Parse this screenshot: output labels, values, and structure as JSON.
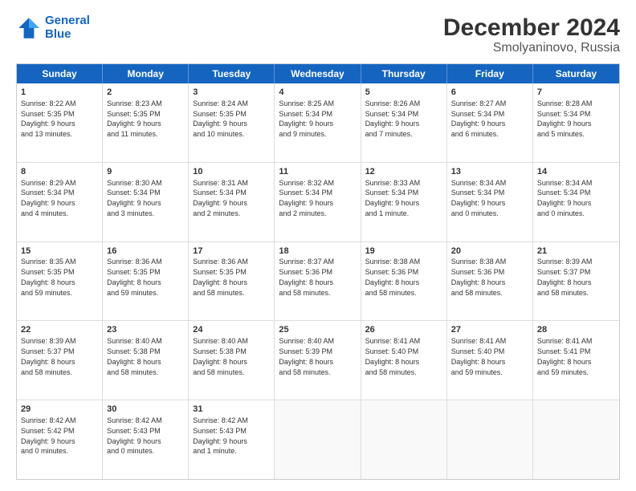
{
  "header": {
    "logo_line1": "General",
    "logo_line2": "Blue",
    "main_title": "December 2024",
    "subtitle": "Smolyaninovo, Russia"
  },
  "calendar": {
    "days_of_week": [
      "Sunday",
      "Monday",
      "Tuesday",
      "Wednesday",
      "Thursday",
      "Friday",
      "Saturday"
    ],
    "weeks": [
      [
        {
          "day": "",
          "text": "",
          "empty": true
        },
        {
          "day": "",
          "text": "",
          "empty": true
        },
        {
          "day": "",
          "text": "",
          "empty": true
        },
        {
          "day": "",
          "text": "",
          "empty": true
        },
        {
          "day": "5",
          "text": "Sunrise: 8:26 AM\nSunset: 5:34 PM\nDaylight: 9 hours\nand 7 minutes.",
          "empty": false
        },
        {
          "day": "6",
          "text": "Sunrise: 8:27 AM\nSunset: 5:34 PM\nDaylight: 9 hours\nand 6 minutes.",
          "empty": false
        },
        {
          "day": "7",
          "text": "Sunrise: 8:28 AM\nSunset: 5:34 PM\nDaylight: 9 hours\nand 5 minutes.",
          "empty": false
        }
      ],
      [
        {
          "day": "1",
          "text": "Sunrise: 8:22 AM\nSunset: 5:35 PM\nDaylight: 9 hours\nand 13 minutes.",
          "empty": false
        },
        {
          "day": "2",
          "text": "Sunrise: 8:23 AM\nSunset: 5:35 PM\nDaylight: 9 hours\nand 11 minutes.",
          "empty": false
        },
        {
          "day": "3",
          "text": "Sunrise: 8:24 AM\nSunset: 5:35 PM\nDaylight: 9 hours\nand 10 minutes.",
          "empty": false
        },
        {
          "day": "4",
          "text": "Sunrise: 8:25 AM\nSunset: 5:34 PM\nDaylight: 9 hours\nand 9 minutes.",
          "empty": false
        },
        {
          "day": "5",
          "text": "Sunrise: 8:26 AM\nSunset: 5:34 PM\nDaylight: 9 hours\nand 7 minutes.",
          "empty": false
        },
        {
          "day": "6",
          "text": "Sunrise: 8:27 AM\nSunset: 5:34 PM\nDaylight: 9 hours\nand 6 minutes.",
          "empty": false
        },
        {
          "day": "7",
          "text": "Sunrise: 8:28 AM\nSunset: 5:34 PM\nDaylight: 9 hours\nand 5 minutes.",
          "empty": false
        }
      ],
      [
        {
          "day": "8",
          "text": "Sunrise: 8:29 AM\nSunset: 5:34 PM\nDaylight: 9 hours\nand 4 minutes.",
          "empty": false
        },
        {
          "day": "9",
          "text": "Sunrise: 8:30 AM\nSunset: 5:34 PM\nDaylight: 9 hours\nand 3 minutes.",
          "empty": false
        },
        {
          "day": "10",
          "text": "Sunrise: 8:31 AM\nSunset: 5:34 PM\nDaylight: 9 hours\nand 2 minutes.",
          "empty": false
        },
        {
          "day": "11",
          "text": "Sunrise: 8:32 AM\nSunset: 5:34 PM\nDaylight: 9 hours\nand 2 minutes.",
          "empty": false
        },
        {
          "day": "12",
          "text": "Sunrise: 8:33 AM\nSunset: 5:34 PM\nDaylight: 9 hours\nand 1 minute.",
          "empty": false
        },
        {
          "day": "13",
          "text": "Sunrise: 8:34 AM\nSunset: 5:34 PM\nDaylight: 9 hours\nand 0 minutes.",
          "empty": false
        },
        {
          "day": "14",
          "text": "Sunrise: 8:34 AM\nSunset: 5:34 PM\nDaylight: 9 hours\nand 0 minutes.",
          "empty": false
        }
      ],
      [
        {
          "day": "15",
          "text": "Sunrise: 8:35 AM\nSunset: 5:35 PM\nDaylight: 8 hours\nand 59 minutes.",
          "empty": false
        },
        {
          "day": "16",
          "text": "Sunrise: 8:36 AM\nSunset: 5:35 PM\nDaylight: 8 hours\nand 59 minutes.",
          "empty": false
        },
        {
          "day": "17",
          "text": "Sunrise: 8:36 AM\nSunset: 5:35 PM\nDaylight: 8 hours\nand 58 minutes.",
          "empty": false
        },
        {
          "day": "18",
          "text": "Sunrise: 8:37 AM\nSunset: 5:36 PM\nDaylight: 8 hours\nand 58 minutes.",
          "empty": false
        },
        {
          "day": "19",
          "text": "Sunrise: 8:38 AM\nSunset: 5:36 PM\nDaylight: 8 hours\nand 58 minutes.",
          "empty": false
        },
        {
          "day": "20",
          "text": "Sunrise: 8:38 AM\nSunset: 5:36 PM\nDaylight: 8 hours\nand 58 minutes.",
          "empty": false
        },
        {
          "day": "21",
          "text": "Sunrise: 8:39 AM\nSunset: 5:37 PM\nDaylight: 8 hours\nand 58 minutes.",
          "empty": false
        }
      ],
      [
        {
          "day": "22",
          "text": "Sunrise: 8:39 AM\nSunset: 5:37 PM\nDaylight: 8 hours\nand 58 minutes.",
          "empty": false
        },
        {
          "day": "23",
          "text": "Sunrise: 8:40 AM\nSunset: 5:38 PM\nDaylight: 8 hours\nand 58 minutes.",
          "empty": false
        },
        {
          "day": "24",
          "text": "Sunrise: 8:40 AM\nSunset: 5:38 PM\nDaylight: 8 hours\nand 58 minutes.",
          "empty": false
        },
        {
          "day": "25",
          "text": "Sunrise: 8:40 AM\nSunset: 5:39 PM\nDaylight: 8 hours\nand 58 minutes.",
          "empty": false
        },
        {
          "day": "26",
          "text": "Sunrise: 8:41 AM\nSunset: 5:40 PM\nDaylight: 8 hours\nand 58 minutes.",
          "empty": false
        },
        {
          "day": "27",
          "text": "Sunrise: 8:41 AM\nSunset: 5:40 PM\nDaylight: 8 hours\nand 59 minutes.",
          "empty": false
        },
        {
          "day": "28",
          "text": "Sunrise: 8:41 AM\nSunset: 5:41 PM\nDaylight: 8 hours\nand 59 minutes.",
          "empty": false
        }
      ],
      [
        {
          "day": "29",
          "text": "Sunrise: 8:42 AM\nSunset: 5:42 PM\nDaylight: 9 hours\nand 0 minutes.",
          "empty": false
        },
        {
          "day": "30",
          "text": "Sunrise: 8:42 AM\nSunset: 5:43 PM\nDaylight: 9 hours\nand 0 minutes.",
          "empty": false
        },
        {
          "day": "31",
          "text": "Sunrise: 8:42 AM\nSunset: 5:43 PM\nDaylight: 9 hours\nand 1 minute.",
          "empty": false
        },
        {
          "day": "",
          "text": "",
          "empty": true
        },
        {
          "day": "",
          "text": "",
          "empty": true
        },
        {
          "day": "",
          "text": "",
          "empty": true
        },
        {
          "day": "",
          "text": "",
          "empty": true
        }
      ]
    ]
  }
}
